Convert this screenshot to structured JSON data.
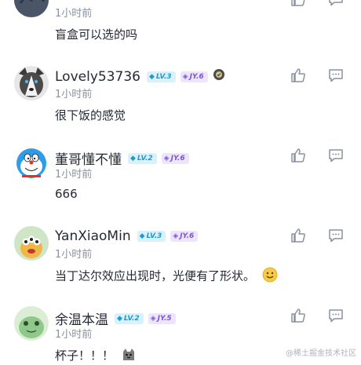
{
  "comments": [
    {
      "username": "",
      "time": "1小时前",
      "text": "盲盒可以选的吗",
      "badges": []
    },
    {
      "username": "Lovely53736",
      "time": "1小时前",
      "text": "很下饭的感觉",
      "badges": [
        {
          "label": "LV.3",
          "type": "lv"
        },
        {
          "label": "JY.6",
          "type": "jy"
        }
      ],
      "has_verified_icon": true
    },
    {
      "username": "董哥懂不懂",
      "time": "1小时前",
      "text": "666",
      "badges": [
        {
          "label": "LV.2",
          "type": "lv"
        },
        {
          "label": "JY.6",
          "type": "jy"
        }
      ]
    },
    {
      "username": "YanXiaoMin",
      "time": "1小时前",
      "text": "当丁达尔效应出现时，光便有了形状。",
      "badges": [
        {
          "label": "LV.3",
          "type": "lv"
        },
        {
          "label": "JY.6",
          "type": "jy"
        }
      ],
      "emoji": "smile-emoji"
    },
    {
      "username": "余温本温",
      "time": "1小时前",
      "text": "杯子！！！",
      "badges": [
        {
          "label": "LV.2",
          "type": "lv"
        },
        {
          "label": "JY.5",
          "type": "jy"
        }
      ],
      "emoji": "cat-emoji"
    }
  ],
  "watermark": "@稀土掘金技术社区",
  "colors": {
    "text": "#252933",
    "muted": "#8a919f",
    "lv": "#1e9bd0",
    "jy": "#7b54d6"
  }
}
